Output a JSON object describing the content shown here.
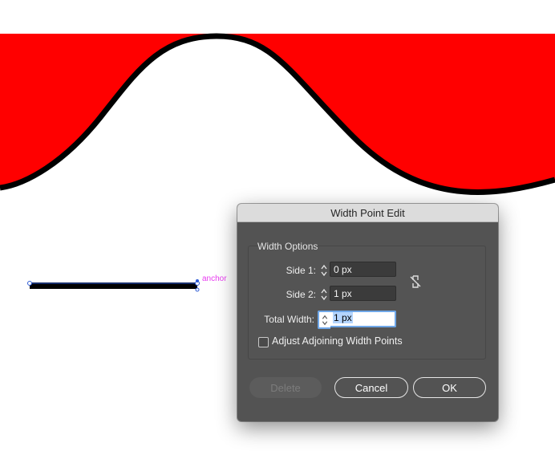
{
  "canvas": {
    "anchor_label": "anchor",
    "colors": {
      "fill": "#ff0000",
      "stroke": "#000000",
      "anchor_label": "#e83cf0",
      "selection": "#2e5bd4"
    }
  },
  "dialog": {
    "title": "Width Point Edit",
    "group_title": "Width Options",
    "side1": {
      "label": "Side 1:",
      "value": "0 px"
    },
    "side2": {
      "label": "Side 2:",
      "value": "1 px"
    },
    "total_width": {
      "label": "Total Width:",
      "value": "1 px"
    },
    "link_icon": "unlink-icon",
    "adjust_checkbox": {
      "label": "Adjust Adjoining Width Points",
      "checked": false
    },
    "buttons": {
      "delete": "Delete",
      "cancel": "Cancel",
      "ok": "OK"
    }
  }
}
